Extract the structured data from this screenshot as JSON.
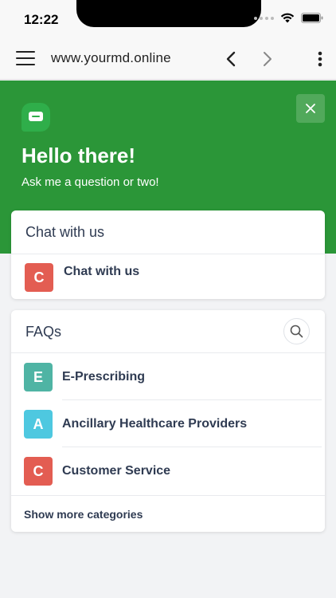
{
  "status_bar": {
    "time": "12:22"
  },
  "browser": {
    "url": "www.yourmd.online"
  },
  "hero": {
    "title": "Hello there!",
    "subtitle": "Ask me a question or two!",
    "bg_color": "#2b9638"
  },
  "chat_card": {
    "title": "Chat with us",
    "item": {
      "letter": "C",
      "label": "Chat with us",
      "color": "#e35d52"
    }
  },
  "faq_card": {
    "title": "FAQs",
    "items": [
      {
        "letter": "E",
        "label": "E-Prescribing",
        "color": "#4fb4a4"
      },
      {
        "letter": "A",
        "label": "Ancillary Healthcare Providers",
        "color": "#4ec8e0"
      },
      {
        "letter": "C",
        "label": "Customer Service",
        "color": "#e35d52"
      }
    ],
    "show_more": "Show more categories"
  },
  "icons": [
    "signal-dots-icon",
    "wifi-icon",
    "battery-icon",
    "hamburger-icon",
    "back-arrow-icon",
    "forward-arrow-icon",
    "more-vertical-icon",
    "chat-bubble-icon",
    "close-icon",
    "search-icon"
  ]
}
